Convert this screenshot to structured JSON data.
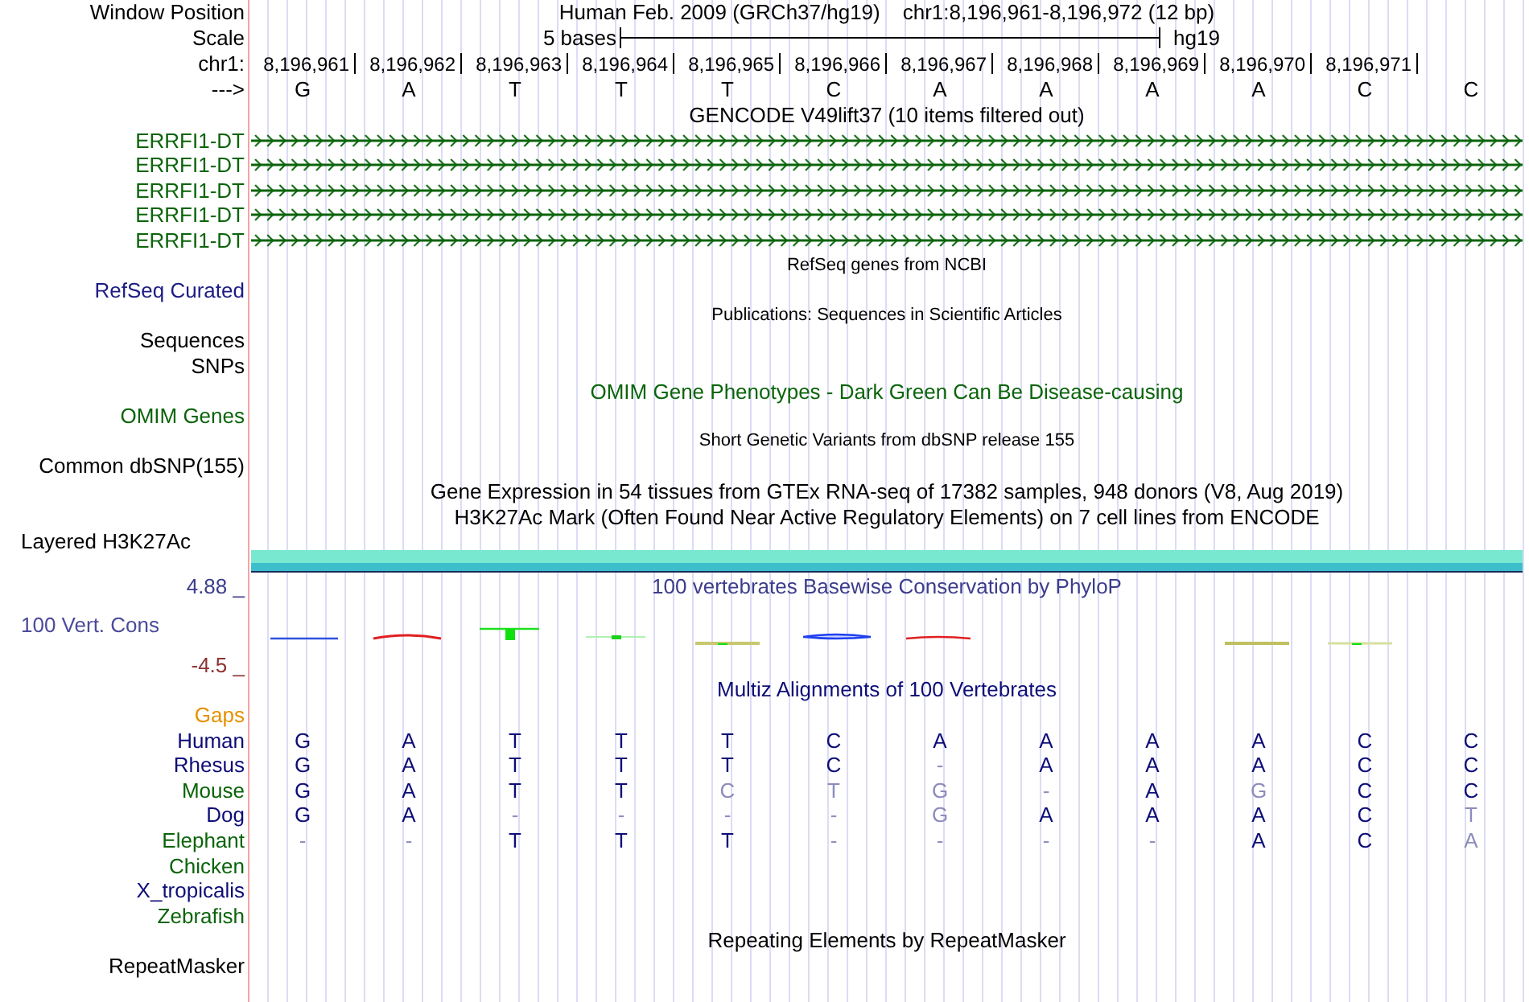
{
  "header": {
    "position_label": "Window Position",
    "genome": "Human Feb. 2009 (GRCh37/hg19)",
    "region": "chr1:8,196,961-8,196,972 (12 bp)",
    "scale_label": "Scale",
    "scale_text": "5 bases",
    "assembly": "hg19",
    "chrom_label": "chr1:",
    "positions": [
      "8,196,961",
      "8,196,962",
      "8,196,963",
      "8,196,964",
      "8,196,965",
      "8,196,966",
      "8,196,967",
      "8,196,968",
      "8,196,969",
      "8,196,970",
      "8,196,971"
    ],
    "strand_label": "--->",
    "bases": [
      "G",
      "A",
      "T",
      "T",
      "T",
      "C",
      "A",
      "A",
      "A",
      "A",
      "C",
      "C"
    ]
  },
  "tracks": [
    {
      "kind": "genes",
      "title": "GENCODE V49lift37 (10 items filtered out)",
      "color": "#000000",
      "items": [
        {
          "label": "ERRFI1-DT",
          "color": "#0a640a"
        },
        {
          "label": "ERRFI1-DT",
          "color": "#0a640a"
        },
        {
          "label": "ERRFI1-DT",
          "color": "#0a640a"
        },
        {
          "label": "ERRFI1-DT",
          "color": "#0a640a"
        },
        {
          "label": "ERRFI1-DT",
          "color": "#0a640a"
        }
      ]
    },
    {
      "kind": "compact",
      "title": "RefSeq genes from NCBI",
      "color": "#000000",
      "labels": [
        {
          "text": "RefSeq Curated",
          "color": "#1c1c84"
        }
      ]
    },
    {
      "kind": "compact",
      "title": "Publications: Sequences in Scientific Articles",
      "color": "#000000",
      "labels": [
        {
          "text": "Sequences",
          "color": "#000000"
        },
        {
          "text": "SNPs",
          "color": "#000000"
        }
      ]
    },
    {
      "kind": "full",
      "title": "OMIM Gene Phenotypes - Dark Green Can Be Disease-causing",
      "color": "#0a640a",
      "labels": [
        {
          "text": "OMIM Genes",
          "color": "#0a640a"
        }
      ]
    },
    {
      "kind": "compact",
      "title": "Short Genetic Variants from dbSNP release 155",
      "color": "#000000",
      "labels": [
        {
          "text": "Common dbSNP(155)",
          "color": "#000000"
        }
      ]
    },
    {
      "kind": "full",
      "title": "Gene Expression in 54 tissues from GTEx RNA-seq of 17382 samples, 948 donors (V8, Aug 2019)",
      "color": "#000000"
    },
    {
      "kind": "bar",
      "title": "H3K27Ac Mark (Often Found Near Active Regulatory Elements) on 7 cell lines from ENCODE",
      "color": "#000000",
      "label": {
        "text": "Layered H3K27Ac",
        "color": "#000000"
      }
    },
    {
      "kind": "wiggle",
      "title": "100 vertebrates Basewise Conservation by PhyloP",
      "color": "#3c3c8c",
      "max": {
        "text": "4.88 _",
        "color": "#3c3c8c"
      },
      "label": {
        "text": "100 Vert. Cons",
        "color": "#4b4b9b"
      },
      "min": {
        "text": "-4.5 _",
        "color": "#8b3232"
      }
    },
    {
      "kind": "alignment",
      "title": "Multiz Alignments of 100 Vertebrates",
      "color": "#0d0d78",
      "gaps": {
        "text": "Gaps",
        "color": "#e69100"
      },
      "species": [
        {
          "name": "Human",
          "color": "#0d0d78",
          "bases": [
            {
              "b": "G",
              "match": true
            },
            {
              "b": "A",
              "match": true
            },
            {
              "b": "T",
              "match": true
            },
            {
              "b": "T",
              "match": true
            },
            {
              "b": "T",
              "match": true
            },
            {
              "b": "C",
              "match": true
            },
            {
              "b": "A",
              "match": true
            },
            {
              "b": "A",
              "match": true
            },
            {
              "b": "A",
              "match": true
            },
            {
              "b": "A",
              "match": true
            },
            {
              "b": "C",
              "match": true
            },
            {
              "b": "C",
              "match": true
            }
          ]
        },
        {
          "name": "Rhesus",
          "color": "#0d0d78",
          "bases": [
            {
              "b": "G",
              "match": true
            },
            {
              "b": "A",
              "match": true
            },
            {
              "b": "T",
              "match": true
            },
            {
              "b": "T",
              "match": true
            },
            {
              "b": "T",
              "match": true
            },
            {
              "b": "C",
              "match": true
            },
            {
              "b": "-",
              "match": false
            },
            {
              "b": "A",
              "match": true
            },
            {
              "b": "A",
              "match": true
            },
            {
              "b": "A",
              "match": true
            },
            {
              "b": "C",
              "match": true
            },
            {
              "b": "C",
              "match": true
            }
          ]
        },
        {
          "name": "Mouse",
          "color": "#0a640a",
          "bases": [
            {
              "b": "G",
              "match": true
            },
            {
              "b": "A",
              "match": true
            },
            {
              "b": "T",
              "match": true
            },
            {
              "b": "T",
              "match": true
            },
            {
              "b": "C",
              "match": false
            },
            {
              "b": "T",
              "match": false
            },
            {
              "b": "G",
              "match": false
            },
            {
              "b": "-",
              "match": false
            },
            {
              "b": "A",
              "match": true
            },
            {
              "b": "G",
              "match": false
            },
            {
              "b": "C",
              "match": true
            },
            {
              "b": "C",
              "match": true
            }
          ]
        },
        {
          "name": "Dog",
          "color": "#0d0d78",
          "bases": [
            {
              "b": "G",
              "match": true
            },
            {
              "b": "A",
              "match": true
            },
            {
              "b": "-",
              "match": false
            },
            {
              "b": "-",
              "match": false
            },
            {
              "b": "-",
              "match": false
            },
            {
              "b": "-",
              "match": false
            },
            {
              "b": "G",
              "match": false
            },
            {
              "b": "A",
              "match": true
            },
            {
              "b": "A",
              "match": true
            },
            {
              "b": "A",
              "match": true
            },
            {
              "b": "C",
              "match": true
            },
            {
              "b": "T",
              "match": false
            }
          ]
        },
        {
          "name": "Elephant",
          "color": "#0a640a",
          "bases": [
            {
              "b": "-",
              "match": false
            },
            {
              "b": "-",
              "match": false
            },
            {
              "b": "T",
              "match": true
            },
            {
              "b": "T",
              "match": true
            },
            {
              "b": "T",
              "match": true
            },
            {
              "b": "-",
              "match": false
            },
            {
              "b": "-",
              "match": false
            },
            {
              "b": "-",
              "match": false
            },
            {
              "b": "-",
              "match": false
            },
            {
              "b": "A",
              "match": true
            },
            {
              "b": "C",
              "match": true
            },
            {
              "b": "A",
              "match": false
            }
          ]
        },
        {
          "name": "Chicken",
          "color": "#0a640a"
        },
        {
          "name": "X_tropicalis",
          "color": "#0d0d78"
        },
        {
          "name": "Zebrafish",
          "color": "#0a640a"
        }
      ]
    },
    {
      "kind": "full",
      "title": "Repeating Elements by RepeatMasker",
      "color": "#000000",
      "labels": [
        {
          "text": "RepeatMasker",
          "color": "#000000"
        }
      ]
    }
  ]
}
